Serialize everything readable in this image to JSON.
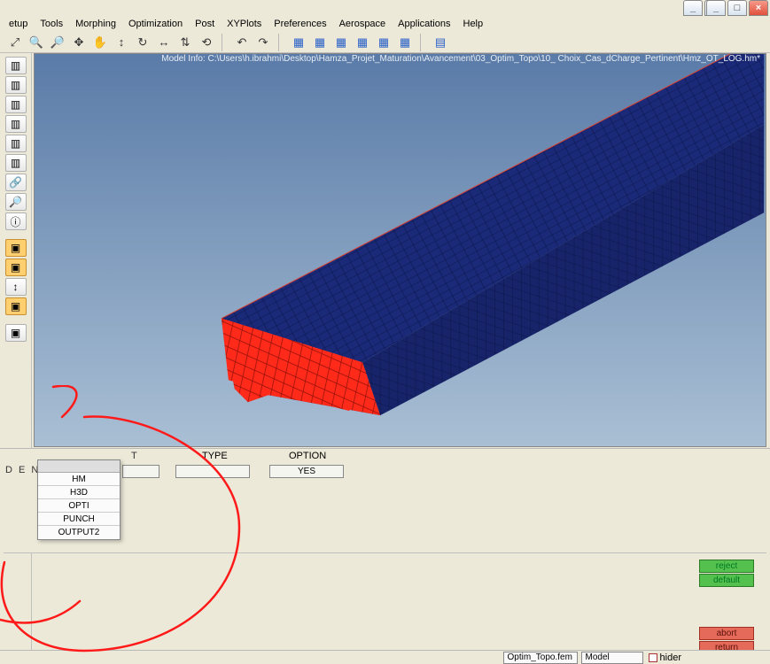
{
  "window_controls": {
    "minimize": "_",
    "maximize": "□",
    "close": "×"
  },
  "prev_window_controls": {
    "minimize": "_",
    "maximize": "□",
    "close": "×"
  },
  "menu": [
    "etup",
    "Tools",
    "Morphing",
    "Optimization",
    "Post",
    "XYPlots",
    "Preferences",
    "Aerospace",
    "Applications",
    "Help"
  ],
  "toolbar_icons": [
    "⤢",
    "🔍",
    "🔎",
    "✥",
    "✋",
    "↕",
    "↻",
    "↔",
    "⇅",
    "⟲",
    "",
    "↶",
    "↷",
    "",
    "▦",
    "▦",
    "▦",
    "▦",
    "▦",
    "▦",
    "",
    "▤"
  ],
  "vtoolbar": [
    "▥",
    "▥",
    "▥",
    "▥",
    "▥",
    "▥",
    "🔗",
    "🔎",
    "ⓘ",
    "▣",
    "▣",
    "↕",
    "▣",
    "",
    "▣"
  ],
  "vtoolbar_selected": [
    10,
    11,
    13
  ],
  "model_info": "Model Info: C:\\Users\\h.ibrahmi\\Desktop\\Hamza_Projet_Maturation\\Avancement\\03_Optim_Topo\\10_ Choix_Cas_dCharge_Pertinent\\Hmz_OT_LOG.hm*",
  "panel": {
    "headers": {
      "t": "T",
      "type": "TYPE",
      "option": "OPTION"
    },
    "row_label": "D E N",
    "option_value": "YES",
    "dropdown_items": [
      "HM",
      "H3D",
      "OPTI",
      "PUNCH",
      "OUTPUT2"
    ]
  },
  "buttons": {
    "reject": "reject",
    "default": "default",
    "abort": "abort",
    "return": "return"
  },
  "status": {
    "field1": "Optim_Topo.fem",
    "field2": "Model",
    "check1": "hider"
  }
}
